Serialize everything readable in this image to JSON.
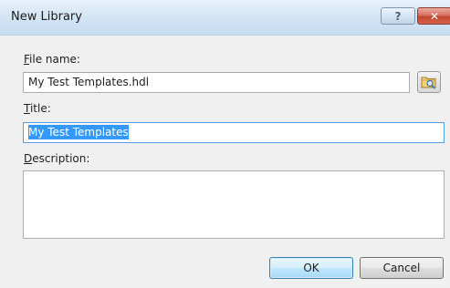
{
  "window": {
    "title": "New Library",
    "help_glyph": "?",
    "close_glyph": "✕"
  },
  "form": {
    "file_name": {
      "label_mnemonic": "F",
      "label_rest": "ile name:",
      "value": "My Test Templates.hdl"
    },
    "browse_icon": "folder-browse-icon",
    "title": {
      "label_mnemonic": "T",
      "label_rest": "itle:",
      "value": "My Test Templates",
      "selected": true
    },
    "description": {
      "label_mnemonic": "D",
      "label_rest": "escription:",
      "value": ""
    }
  },
  "buttons": {
    "ok_label": "OK",
    "cancel_label": "Cancel"
  },
  "colors": {
    "titlebar": "#d5e6f5",
    "close_button": "#c4452f",
    "selection": "#3399ff",
    "focus_border": "#569de5",
    "default_button": "#bee6fd"
  }
}
